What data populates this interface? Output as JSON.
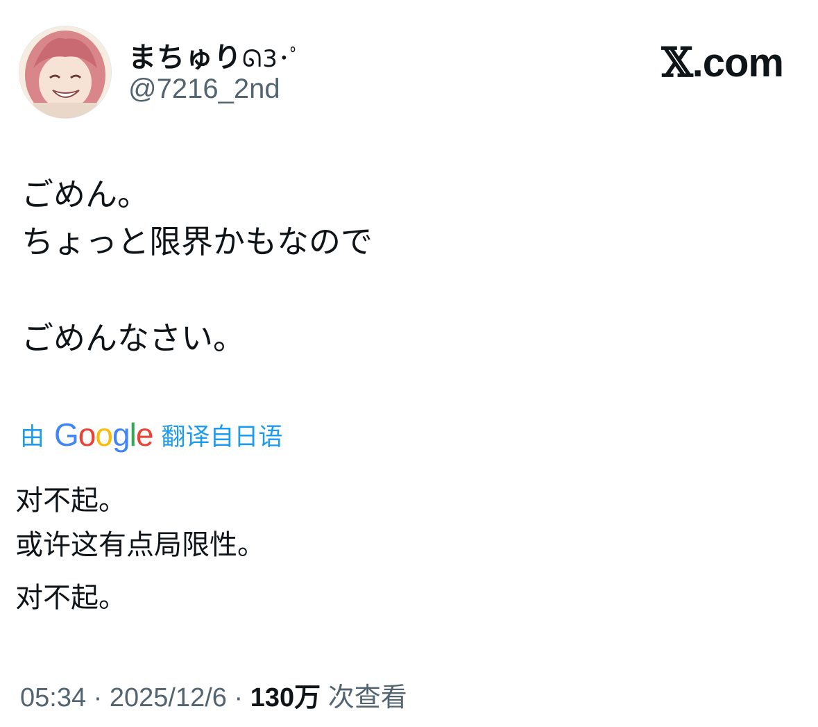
{
  "user": {
    "display_name": "まちゅり",
    "name_emoji": "ᘏ3･ﾟ",
    "handle": "@7216_2nd"
  },
  "brand": {
    "x_glyph": "𝕏",
    "suffix": ".com"
  },
  "tweet": {
    "lines": [
      "ごめん。",
      "ちょっと限界かもなので",
      "ごめんなさい。"
    ]
  },
  "translation": {
    "prefix": "由",
    "google_letters": [
      "G",
      "o",
      "o",
      "g",
      "l",
      "e"
    ],
    "google_colors": [
      "#4285F4",
      "#EA4335",
      "#FBBC05",
      "#4285F4",
      "#34A853",
      "#EA4335"
    ],
    "suffix": "翻译自日语",
    "lines": [
      "对不起。",
      "或许这有点局限性。",
      "对不起。"
    ]
  },
  "meta": {
    "time": "05:34",
    "date": "2025/12/6",
    "views_count": "130万",
    "views_label": "次查看",
    "separator": "·"
  },
  "colors": {
    "link_blue": "#1d9bf0",
    "secondary_text": "#536471",
    "primary_text": "#0f1419"
  }
}
